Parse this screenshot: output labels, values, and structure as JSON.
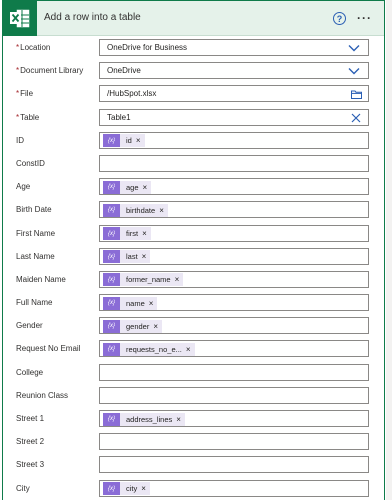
{
  "header": {
    "title": "Add a row into a table",
    "help_icon": "?",
    "more_icon": "···",
    "logo": "excel-icon",
    "accent": "#0f7b4a"
  },
  "rows": [
    {
      "label": "Location",
      "required": true,
      "kind": "dropdown",
      "value": "OneDrive for Business"
    },
    {
      "label": "Document Library",
      "required": true,
      "kind": "dropdown",
      "value": "OneDrive"
    },
    {
      "label": "File",
      "required": true,
      "kind": "file",
      "value": "/HubSpot.xlsx"
    },
    {
      "label": "Table",
      "required": true,
      "kind": "clear",
      "value": "Table1"
    },
    {
      "label": "ID",
      "required": false,
      "kind": "token",
      "value": "id"
    },
    {
      "label": "ConstID",
      "required": false,
      "kind": "empty",
      "value": ""
    },
    {
      "label": "Age",
      "required": false,
      "kind": "token",
      "value": "age"
    },
    {
      "label": "Birth Date",
      "required": false,
      "kind": "token",
      "value": "birthdate"
    },
    {
      "label": "First Name",
      "required": false,
      "kind": "token",
      "value": "first"
    },
    {
      "label": "Last Name",
      "required": false,
      "kind": "token",
      "value": "last"
    },
    {
      "label": "Maiden Name",
      "required": false,
      "kind": "token",
      "value": "former_name"
    },
    {
      "label": "Full Name",
      "required": false,
      "kind": "token",
      "value": "name"
    },
    {
      "label": "Gender",
      "required": false,
      "kind": "token",
      "value": "gender"
    },
    {
      "label": "Request No Email",
      "required": false,
      "kind": "token",
      "value": "requests_no_e..."
    },
    {
      "label": "College",
      "required": false,
      "kind": "empty",
      "value": ""
    },
    {
      "label": "Reunion Class",
      "required": false,
      "kind": "empty",
      "value": ""
    },
    {
      "label": "Street 1",
      "required": false,
      "kind": "token",
      "value": "address_lines"
    },
    {
      "label": "Street 2",
      "required": false,
      "kind": "empty",
      "value": ""
    },
    {
      "label": "Street 3",
      "required": false,
      "kind": "empty",
      "value": ""
    },
    {
      "label": "City",
      "required": false,
      "kind": "token",
      "value": "city"
    }
  ],
  "token_icon_text": "{x}",
  "token_remove": "×"
}
